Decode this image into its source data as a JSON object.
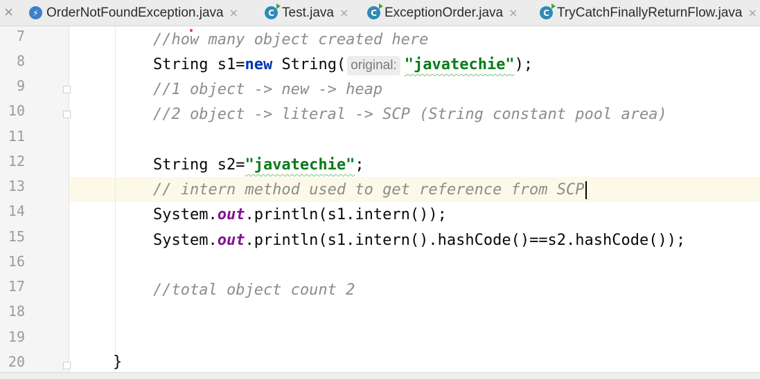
{
  "tabs": [
    {
      "label": "OrderNotFoundException.java",
      "icon": "exception-class-icon"
    },
    {
      "label": "Test.java",
      "icon": "runnable-class-icon"
    },
    {
      "label": "ExceptionOrder.java",
      "icon": "runnable-class-icon"
    },
    {
      "label": "TryCatchFinallyReturnFlow.java",
      "icon": "runnable-class-icon"
    }
  ],
  "gutter": {
    "line_numbers": [
      "7",
      "8",
      "9",
      "10",
      "11",
      "12",
      "13",
      "14",
      "15",
      "16",
      "17",
      "18",
      "19",
      "20"
    ]
  },
  "code": {
    "l7": {
      "comment": "//how many object created here"
    },
    "l8": {
      "type": "String",
      "rest1": " s1=",
      "kw": "new",
      "type2": " String(",
      "hint": "original:",
      "literal": "\"javatechie\"",
      "end": ");"
    },
    "l9": {
      "comment": "//1 object -> new -> heap"
    },
    "l10": {
      "comment": "//2 object -> literal -> SCP (String constant pool area)"
    },
    "l12": {
      "prefix": "String s2=",
      "literal": "\"javatechie\"",
      "end": ";"
    },
    "l13": {
      "comment": "// intern method used to get reference from SCP"
    },
    "l14": {
      "prefix": "System.",
      "field": "out",
      "rest": ".println(s1.intern());"
    },
    "l15": {
      "prefix": "System.",
      "field": "out",
      "rest": ".println(s1.intern().hashCode()==s2.hashCode());"
    },
    "l17": {
      "comment": "//total object count 2"
    },
    "l20": {
      "brace": "}"
    }
  },
  "colors": {
    "keyword": "#0033b3",
    "string": "#067d17",
    "comment": "#8c8c8c",
    "static_field": "#871094",
    "current_line": "#fcf9e8"
  }
}
